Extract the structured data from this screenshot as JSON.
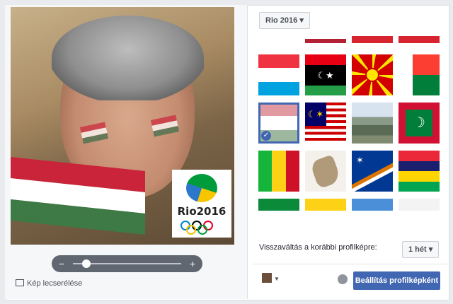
{
  "filter_dropdown": {
    "label": "Rio 2016",
    "icon": "caret-down-icon"
  },
  "change_photo": {
    "label": "Kép lecserélése",
    "icon": "photo-icon"
  },
  "slider": {
    "minus": "−",
    "plus": "+",
    "value": 0.12
  },
  "revert": {
    "label": "Visszaváltás a korábbi profilképre:",
    "duration": "1 hét"
  },
  "actions": {
    "set_button": "Beállítás profilképként"
  },
  "overlay": {
    "text": "Rio2016"
  },
  "colors": {
    "accent": "#4267b2",
    "slider": "#606770"
  },
  "flags": [
    {
      "name": "flag-partial-1"
    },
    {
      "name": "flag-partial-2"
    },
    {
      "name": "flag-partial-3"
    },
    {
      "name": "flag-partial-4"
    },
    {
      "name": "flag-luxembourg"
    },
    {
      "name": "flag-libya"
    },
    {
      "name": "flag-macedonia"
    },
    {
      "name": "flag-madagascar"
    },
    {
      "name": "flag-hungary",
      "selected": true
    },
    {
      "name": "flag-malaysia"
    },
    {
      "name": "flag-landscape"
    },
    {
      "name": "flag-maldives"
    },
    {
      "name": "flag-mali"
    },
    {
      "name": "flag-map"
    },
    {
      "name": "flag-marshall-islands"
    },
    {
      "name": "flag-mauritius"
    },
    {
      "name": "flag-partial-5"
    },
    {
      "name": "flag-partial-6"
    },
    {
      "name": "flag-partial-7"
    },
    {
      "name": "flag-partial-8"
    }
  ]
}
